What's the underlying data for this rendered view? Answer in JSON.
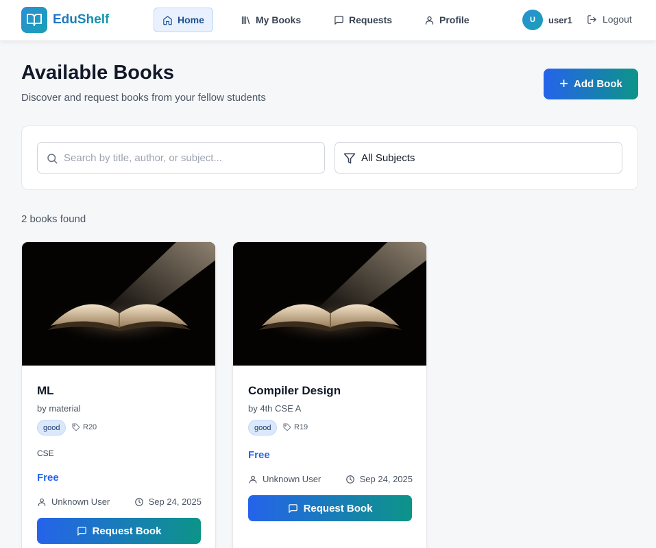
{
  "brand": {
    "name": "EduShelf",
    "icon": "open-book-icon"
  },
  "nav": {
    "items": [
      {
        "label": "Home",
        "icon": "home-icon",
        "active": true
      },
      {
        "label": "My Books",
        "icon": "library-icon",
        "active": false
      },
      {
        "label": "Requests",
        "icon": "message-square-icon",
        "active": false
      },
      {
        "label": "Profile",
        "icon": "user-icon",
        "active": false
      }
    ],
    "user": {
      "initial": "U",
      "name": "user1"
    },
    "logout_label": "Logout"
  },
  "header": {
    "title": "Available Books",
    "subtitle": "Discover and request books from your fellow students",
    "add_book_label": "Add Book"
  },
  "filters": {
    "search_placeholder": "Search by title, author, or subject...",
    "search_value": "",
    "subject_selected": "All Subjects"
  },
  "results": {
    "count_text": "2 books found"
  },
  "books": [
    {
      "title": "ML",
      "author": "by material",
      "condition": "good",
      "regulation": "R20",
      "subject": "CSE",
      "price": "Free",
      "owner": "Unknown User",
      "date": "Sep 24, 2025",
      "request_label": "Request Book"
    },
    {
      "title": "Compiler Design",
      "author": "by 4th CSE A",
      "condition": "good",
      "regulation": "R19",
      "subject": "",
      "price": "Free",
      "owner": "Unknown User",
      "date": "Sep 24, 2025",
      "request_label": "Request Book"
    }
  ],
  "colors": {
    "accent_blue": "#2563eb",
    "accent_teal": "#0d9488",
    "badge_bg": "#dbe8fb",
    "page_bg": "#f6f7f9"
  }
}
